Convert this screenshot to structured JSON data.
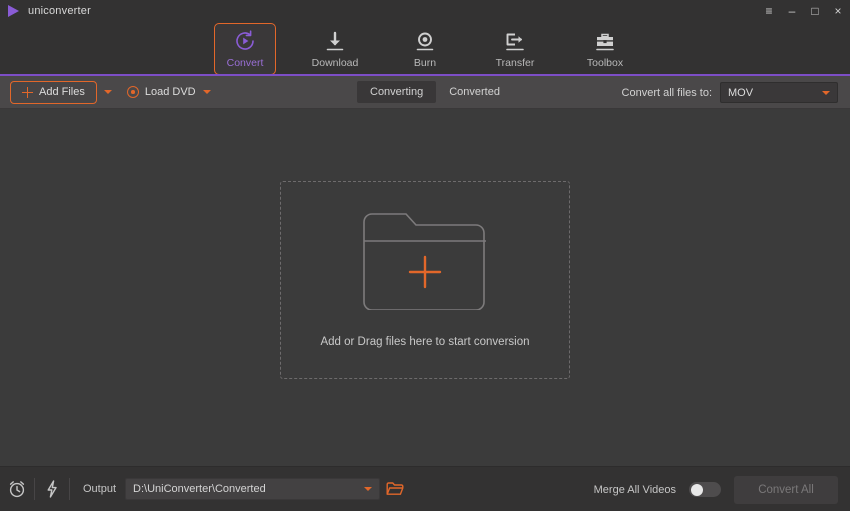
{
  "window": {
    "app_name": "uniconverter",
    "logo_icon": "play-triangle-icon",
    "controls": {
      "menu": "≡",
      "minimize": "–",
      "maximize": "□",
      "close": "×"
    }
  },
  "nav": {
    "items": [
      {
        "label": "Convert",
        "icon": "convert-circular-play-icon",
        "active": true
      },
      {
        "label": "Download",
        "icon": "download-arrow-icon",
        "active": false
      },
      {
        "label": "Burn",
        "icon": "burn-disc-icon",
        "active": false
      },
      {
        "label": "Transfer",
        "icon": "transfer-arrow-out-icon",
        "active": false
      },
      {
        "label": "Toolbox",
        "icon": "toolbox-icon",
        "active": false
      }
    ]
  },
  "toolbar": {
    "add_files_label": "Add Files",
    "add_files_icon": "plus-icon",
    "load_dvd_label": "Load DVD",
    "load_dvd_icon": "disc-icon",
    "dropdown_icon": "caret-down-icon",
    "segments": [
      {
        "label": "Converting",
        "active": true
      },
      {
        "label": "Converted",
        "active": false
      }
    ],
    "convert_all_to_label": "Convert all files to:",
    "format_value": "MOV"
  },
  "content": {
    "dropzone_text": "Add or Drag files here to start conversion",
    "dropzone_icon": "folder-with-plus-icon"
  },
  "bottom": {
    "timer_icon": "alarm-clock-icon",
    "speed_icon": "lightning-bolt-icon",
    "output_label": "Output",
    "output_path": "D:\\UniConverter\\Converted",
    "output_dropdown_icon": "caret-down-icon",
    "browse_icon": "open-folder-icon",
    "merge_label": "Merge All Videos",
    "merge_enabled": false,
    "convert_all_label": "Convert All"
  },
  "colors": {
    "accent_orange": "#e2672a",
    "accent_purple": "#8a5cd6",
    "titlebar_bg": "#333232",
    "toolbar_bg": "#4a4849",
    "content_bg": "#3b3b3b"
  }
}
